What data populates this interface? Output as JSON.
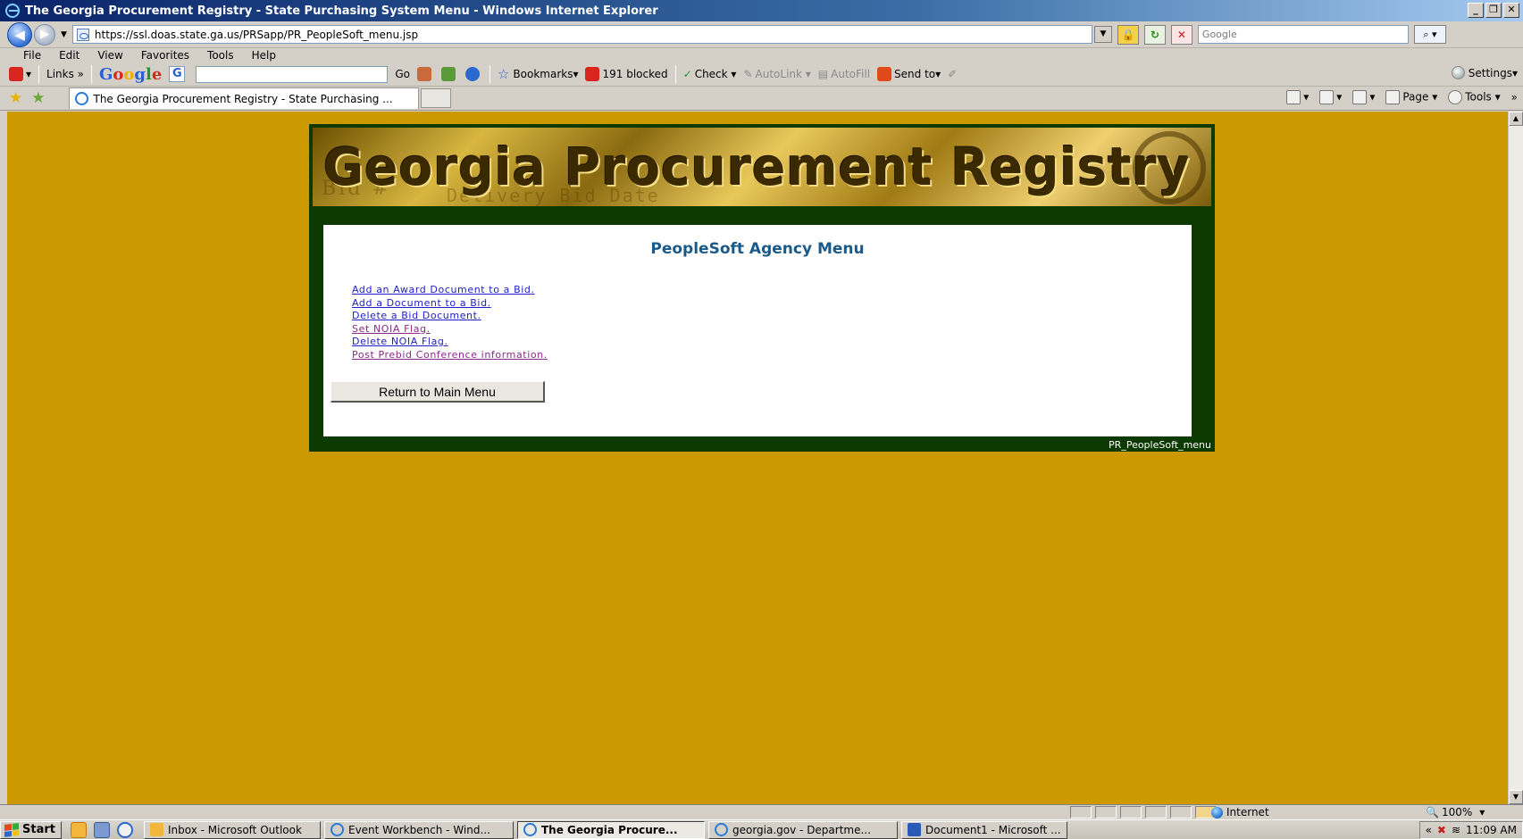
{
  "window": {
    "title": "The Georgia Procurement Registry - State Purchasing System Menu - Windows Internet Explorer"
  },
  "address_bar": {
    "url": "https://ssl.doas.state.ga.us/PRSapp/PR_PeopleSoft_menu.jsp",
    "search_placeholder": "Google"
  },
  "menu_bar": {
    "items": [
      "File",
      "Edit",
      "View",
      "Favorites",
      "Tools",
      "Help"
    ]
  },
  "google_toolbar": {
    "links_label": "Links",
    "logo_letters": [
      "G",
      "o",
      "o",
      "g",
      "l",
      "e"
    ],
    "go_label": "Go",
    "bookmarks_label": "Bookmarks",
    "blocked_label": "191 blocked",
    "check_label": "Check",
    "autolink_label": "AutoLink",
    "autofill_label": "AutoFill",
    "sendto_label": "Send to",
    "settings_label": "Settings"
  },
  "tab_bar": {
    "tab_title": "The Georgia Procurement Registry - State Purchasing ...",
    "page_label": "Page",
    "tools_label": "Tools"
  },
  "page": {
    "banner_title": "Georgia Procurement Registry",
    "banner_ghost_text_1": "Bid #",
    "banner_ghost_text_2": "Delivery Bid Date",
    "heading": "PeopleSoft Agency Menu",
    "links": [
      {
        "label": "Add an Award Document to a Bid.",
        "visited": false
      },
      {
        "label": "Add a Document to a Bid.",
        "visited": false
      },
      {
        "label": "Delete a Bid Document.",
        "visited": false
      },
      {
        "label": "Set NOIA Flag.",
        "visited": true
      },
      {
        "label": "Delete NOIA Flag.",
        "visited": false
      },
      {
        "label": "Post Prebid Conference information.",
        "visited": true
      }
    ],
    "return_button": "Return to Main Menu",
    "page_name": "PR_PeopleSoft_menu"
  },
  "status_bar": {
    "zone": "Internet",
    "zoom": "100%"
  },
  "taskbar": {
    "start_label": "Start",
    "buttons": [
      {
        "label": "Inbox - Microsoft Outlook",
        "active": false
      },
      {
        "label": "Event Workbench - Wind...",
        "active": false
      },
      {
        "label": "The Georgia Procure...",
        "active": true
      },
      {
        "label": "georgia.gov - Departme...",
        "active": false
      },
      {
        "label": "Document1 - Microsoft ...",
        "active": false
      }
    ],
    "clock": "11:09 AM"
  },
  "colors": {
    "page_background": "#cc9900",
    "frame_green": "#0d3a00",
    "heading_blue": "#1a5a8a",
    "link_blue": "#2020c8",
    "link_visited": "#8a2a8a"
  }
}
